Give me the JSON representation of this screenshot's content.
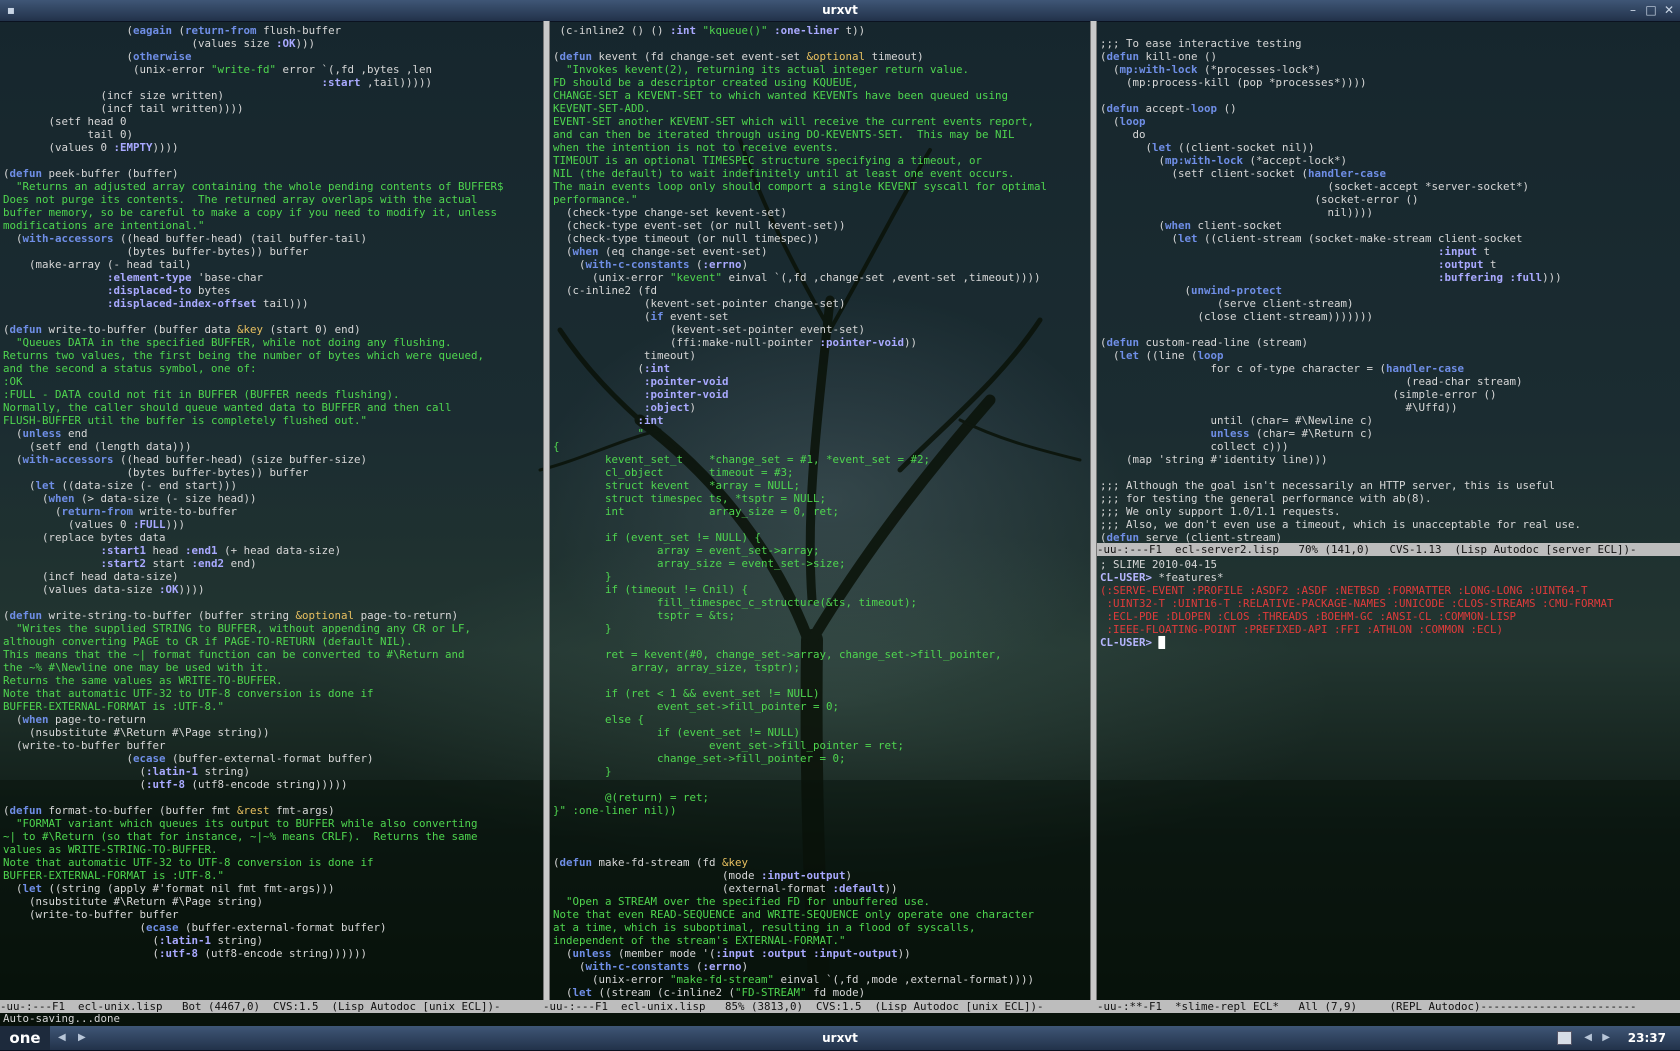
{
  "window": {
    "title": "urxvt"
  },
  "taskbar": {
    "workspace": "one",
    "title": "urxvt",
    "clock": "23:37"
  },
  "pane1": {
    "lines": [
      "                   (eagain (return-from flush-buffer",
      "                             (values size :OK)))",
      "                   (otherwise",
      "                    (unix-error \"write-fd\" error `(,fd ,bytes ,len",
      "                                                 :start ,tail)))))",
      "               (incf size written)",
      "               (incf tail written))))",
      "       (setf head 0",
      "             tail 0)",
      "       (values 0 :EMPTY))))",
      "",
      "(defun peek-buffer (buffer)",
      "  \"Returns an adjusted array containing the whole pending contents of BUFFER$",
      "Does not purge its contents.  The returned array overlaps with the actual",
      "buffer memory, so be careful to make a copy if you need to modify it, unless",
      "modifications are intentional.\"",
      "  (with-accessors ((head buffer-head) (tail buffer-tail)",
      "                   (bytes buffer-bytes)) buffer",
      "    (make-array (- head tail)",
      "                :element-type 'base-char",
      "                :displaced-to bytes",
      "                :displaced-index-offset tail)))",
      "",
      "(defun write-to-buffer (buffer data &key (start 0) end)",
      "  \"Queues DATA in the specified BUFFER, while not doing any flushing.",
      "Returns two values, the first being the number of bytes which were queued,",
      "and the second a status symbol, one of:",
      ":OK",
      ":FULL - DATA could not fit in BUFFER (BUFFER needs flushing).",
      "Normally, the caller should queue wanted data to BUFFER and then call",
      "FLUSH-BUFFER util the buffer is completely flushed out.\"",
      "  (unless end",
      "    (setf end (length data)))",
      "  (with-accessors ((head buffer-head) (size buffer-size)",
      "                   (bytes buffer-bytes)) buffer",
      "    (let ((data-size (- end start)))",
      "      (when (> data-size (- size head))",
      "        (return-from write-to-buffer",
      "          (values 0 :FULL)))",
      "      (replace bytes data",
      "               :start1 head :end1 (+ head data-size)",
      "               :start2 start :end2 end)",
      "      (incf head data-size)",
      "      (values data-size :OK))))",
      "",
      "(defun write-string-to-buffer (buffer string &optional page-to-return)",
      "  \"Writes the supplied STRING to BUFFER, without appending any CR or LF,",
      "although converting PAGE to CR if PAGE-TO-RETURN (default NIL).",
      "This means that the ~| format function can be converted to #\\Return and",
      "the ~% #\\Newline one may be used with it.",
      "Returns the same values as WRITE-TO-BUFFER.",
      "Note that automatic UTF-32 to UTF-8 conversion is done if",
      "BUFFER-EXTERNAL-FORMAT is :UTF-8.\"",
      "  (when page-to-return",
      "    (nsubstitute #\\Return #\\Page string))",
      "  (write-to-buffer buffer",
      "                   (ecase (buffer-external-format buffer)",
      "                     (:latin-1 string)",
      "                     (:utf-8 (utf8-encode string)))))",
      "",
      "(defun format-to-buffer (buffer fmt &rest fmt-args)",
      "  \"FORMAT variant which queues its output to BUFFER while also converting",
      "~| to #\\Return (so that for instance, ~|~% means CRLF).  Returns the same",
      "values as WRITE-STRING-TO-BUFFER.",
      "Note that automatic UTF-32 to UTF-8 conversion is done if",
      "BUFFER-EXTERNAL-FORMAT is :UTF-8.\"",
      "  (let ((string (apply #'format nil fmt fmt-args)))",
      "    (nsubstitute #\\Return #\\Page string)",
      "    (write-to-buffer buffer",
      "                     (ecase (buffer-external-format buffer)",
      "                       (:latin-1 string)",
      "                       (:utf-8 (utf8-encode string))))))"
    ],
    "modeline": "-uu-:---F1  ecl-unix.lisp   Bot (4467,0)  CVS:1.5  (Lisp Autodoc [unix ECL])-"
  },
  "pane2": {
    "lines": [
      " (c-inline2 () () :int \"kqueue()\" :one-liner t))",
      "",
      "(defun kevent (fd change-set event-set &optional timeout)",
      "  \"Invokes kevent(2), returning its actual integer return value.",
      "FD should be a descriptor created using KQUEUE,",
      "CHANGE-SET a KEVENT-SET to which wanted KEVENTs have been queued using",
      "KEVENT-SET-ADD.",
      "EVENT-SET another KEVENT-SET which will receive the current events report,",
      "and can then be iterated through using DO-KEVENTS-SET.  This may be NIL",
      "when the intention is not to receive events.",
      "TIMEOUT is an optional TIMESPEC structure specifying a timeout, or",
      "NIL (the default) to wait indefinitely until at least one event occurs.",
      "The main events loop only should comport a single KEVENT syscall for optimal",
      "performance.\"",
      "  (check-type change-set kevent-set)",
      "  (check-type event-set (or null kevent-set))",
      "  (check-type timeout (or null timespec))",
      "  (when (eq change-set event-set)",
      "    (with-c-constants (:errno)",
      "      (unix-error \"kevent\" einval `(,fd ,change-set ,event-set ,timeout))))",
      "  (c-inline2 (fd",
      "              (kevent-set-pointer change-set)",
      "              (if event-set",
      "                  (kevent-set-pointer event-set)",
      "                  (ffi:make-null-pointer :pointer-void))",
      "              timeout)",
      "             (:int",
      "              :pointer-void",
      "              :pointer-void",
      "              :object)",
      "             :int",
      "             \"",
      "{",
      "        kevent_set_t    *change_set = #1, *event_set = #2;",
      "        cl_object       timeout = #3;",
      "        struct kevent   *array = NULL;",
      "        struct timespec ts, *tsptr = NULL;",
      "        int             array_size = 0, ret;",
      "",
      "        if (event_set != NULL) {",
      "                array = event_set->array;",
      "                array_size = event_set->size;",
      "        }",
      "        if (timeout != Cnil) {",
      "                fill_timespec_c_structure(&ts, timeout);",
      "                tsptr = &ts;",
      "        }",
      "",
      "        ret = kevent(#0, change_set->array, change_set->fill_pointer,",
      "            array, array_size, tsptr);",
      "",
      "        if (ret < 1 && event_set != NULL)",
      "                event_set->fill_pointer = 0;",
      "        else {",
      "                if (event_set != NULL)",
      "                        event_set->fill_pointer = ret;",
      "                change_set->fill_pointer = 0;",
      "        }",
      "",
      "        @(return) = ret;",
      "}\" :one-liner nil))",
      "",
      "",
      "",
      "(defun make-fd-stream (fd &key",
      "                          (mode :input-output)",
      "                          (external-format :default))",
      "  \"Open a STREAM over the specified FD for unbuffered use.",
      "Note that even READ-SEQUENCE and WRITE-SEQUENCE only operate one character",
      "at a time, which is suboptimal, resulting in a flood of syscalls,",
      "independent of the stream's EXTERNAL-FORMAT.\"",
      "  (unless (member mode '(:input :output :input-output))",
      "    (with-c-constants (:errno)",
      "      (unix-error \"make-fd-stream\" einval `(,fd ,mode ,external-format))))",
      "  (let ((stream (c-inline2 (\"FD-STREAM\" fd mode)"
    ],
    "modeline": "-uu-:---F1  ecl-unix.lisp   85% (3813,0)  CVS:1.5  (Lisp Autodoc [unix ECL])-"
  },
  "pane3": {
    "lines": [
      "",
      ";;; To ease interactive testing",
      "(defun kill-one ()",
      "  (mp:with-lock (*processes-lock*)",
      "    (mp:process-kill (pop *processes*))))",
      "",
      "(defun accept-loop ()",
      "  (loop",
      "     do",
      "       (let ((client-socket nil))",
      "         (mp:with-lock (*accept-lock*)",
      "           (setf client-socket (handler-case",
      "                                   (socket-accept *server-socket*)",
      "                                 (socket-error ()",
      "                                   nil))))",
      "         (when client-socket",
      "           (let ((client-stream (socket-make-stream client-socket",
      "                                                    :input t",
      "                                                    :output t",
      "                                                    :buffering :full)))",
      "             (unwind-protect",
      "                  (serve client-stream)",
      "               (close client-stream)))))))",
      "",
      "(defun custom-read-line (stream)",
      "  (let ((line (loop",
      "                 for c of-type character = (handler-case",
      "                                               (read-char stream)",
      "                                             (simple-error ()",
      "                                               #\\Uffd))",
      "                 until (char= #\\Newline c)",
      "                 unless (char= #\\Return c)",
      "                 collect c)))",
      "    (map 'string #'identity line)))",
      "",
      ";;; Although the goal isn't necessarily an HTTP server, this is useful",
      ";;; for testing the general performance with ab(8).",
      ";;; We only support 1.0/1.1 requests.",
      ";;; Also, we don't even use a timeout, which is unacceptable for real use.",
      "(defun serve (client-stream)"
    ],
    "modeline_top": "-uu-:---F1  ecl-server2.lisp   70% (141,0)   CVS-1.13  (Lisp Autodoc [server ECL])-",
    "repl_lines": [
      "; SLIME 2010-04-15",
      "CL-USER> *features*",
      "(:SERVE-EVENT :PROFILE :ASDF2 :ASDF :NETBSD :FORMATTER :LONG-LONG :UINT64-T",
      " :UINT32-T :UINT16-T :RELATIVE-PACKAGE-NAMES :UNICODE :CLOS-STREAMS :CMU-FORMAT",
      " :ECL-PDE :DLOPEN :CLOS :THREADS :BOEHM-GC :ANSI-CL :COMMON-LISP",
      " :IEEE-FLOATING-POINT :PREFIXED-API :FFI :ATHLON :COMMON :ECL)",
      "CL-USER> "
    ],
    "modeline_bottom": "-uu-:**-F1  *slime-repl ECL*   All (7,9)     (REPL Autodoc)------------------------"
  },
  "echo_area": "Auto-saving...done"
}
